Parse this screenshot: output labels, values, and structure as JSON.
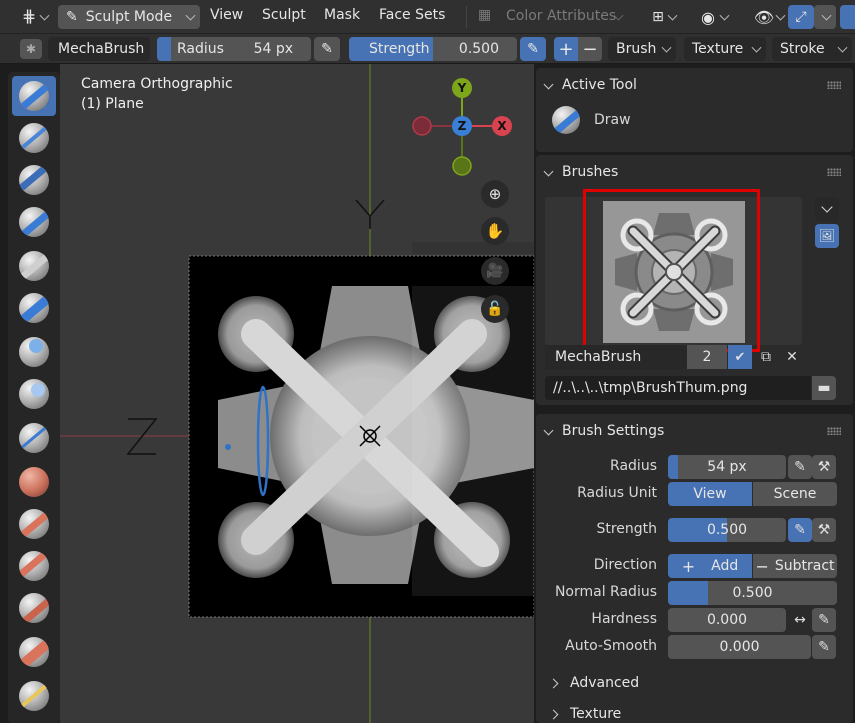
{
  "header": {
    "mode_label": "Sculpt Mode",
    "menus": [
      "View",
      "Sculpt",
      "Mask",
      "Face Sets"
    ],
    "color_attributes_label": "Color Attributes"
  },
  "tool_header": {
    "brush_name": "MechaBrush",
    "radius_label": "Radius",
    "radius_value": "54 px",
    "strength_label": "Strength",
    "strength_value": "0.500",
    "brush_menu": "Brush",
    "texture_menu": "Texture",
    "stroke_menu": "Stroke"
  },
  "viewport": {
    "view_name": "Camera Orthographic",
    "object_name": "(1) Plane",
    "gizmo_axes": {
      "y": "Y",
      "z": "Z",
      "x": "X"
    },
    "axis_label_y": "Y",
    "axis_label_z": "Z"
  },
  "active_tool": {
    "title": "Active Tool",
    "tool_name": "Draw"
  },
  "brushes": {
    "title": "Brushes",
    "brush_name": "MechaBrush",
    "users": "2",
    "image_path": "//..\\..\\..\\tmp\\BrushThum.png"
  },
  "brush_settings": {
    "title": "Brush Settings",
    "radius_label": "Radius",
    "radius_value": "54 px",
    "radius_unit_label": "Radius Unit",
    "unit_view": "View",
    "unit_scene": "Scene",
    "strength_label": "Strength",
    "strength_value": "0.500",
    "direction_label": "Direction",
    "direction_add": "Add",
    "direction_subtract": "Subtract",
    "normal_radius_label": "Normal Radius",
    "normal_radius_value": "0.500",
    "hardness_label": "Hardness",
    "hardness_value": "0.000",
    "auto_smooth_label": "Auto-Smooth",
    "auto_smooth_value": "0.000"
  },
  "subpanels": {
    "advanced": "Advanced",
    "texture": "Texture"
  },
  "colors": {
    "accent": "#4772b3",
    "highlight_box": "#e00000",
    "gizmo_x": "#d9434f",
    "gizmo_y": "#7da61a",
    "gizmo_z": "#3a7fd6"
  }
}
